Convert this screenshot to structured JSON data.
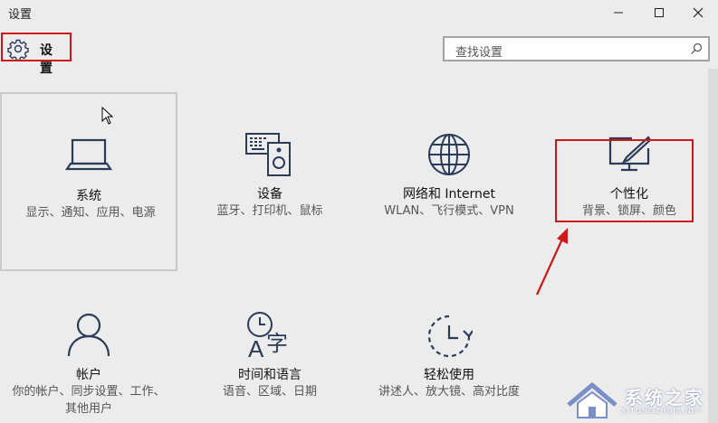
{
  "window": {
    "title": "设置",
    "minimize_label": "Minimize",
    "maximize_label": "Maximize",
    "close_label": "Close"
  },
  "header": {
    "title": "设置"
  },
  "search": {
    "placeholder": "查找设置"
  },
  "tiles": [
    {
      "name": "系统",
      "desc": "显示、通知、应用、电源",
      "icon": "laptop-icon"
    },
    {
      "name": "设备",
      "desc": "蓝牙、打印机、鼠标",
      "icon": "devices-icon"
    },
    {
      "name": "网络和 Internet",
      "desc": "WLAN、飞行模式、VPN",
      "icon": "globe-icon"
    },
    {
      "name": "个性化",
      "desc": "背景、锁屏、颜色",
      "icon": "personalization-icon"
    },
    {
      "name": "帐户",
      "desc": "你的帐户、同步设置、工作、其他用户",
      "icon": "person-icon"
    },
    {
      "name": "时间和语言",
      "desc": "语音、区域、日期",
      "icon": "time-language-icon"
    },
    {
      "name": "轻松使用",
      "desc": "讲述人、放大镜、高对比度",
      "icon": "ease-of-access-icon"
    }
  ],
  "annotation": {
    "highlight_color": "#d01717"
  },
  "watermark": {
    "text": "系统之家",
    "sub": "XITONGZHIJIA.NET"
  },
  "colors": {
    "icon": "#2b3b5a",
    "background": "#ececec",
    "accent_red": "#d01717"
  }
}
